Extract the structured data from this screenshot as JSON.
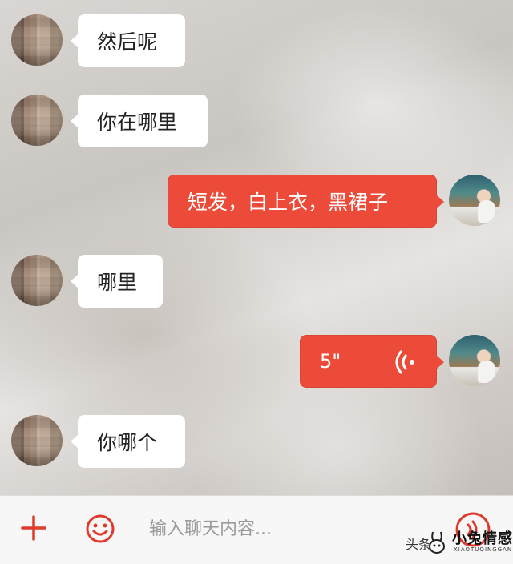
{
  "messages": [
    {
      "side": "in",
      "text": "然后呢"
    },
    {
      "side": "in",
      "text": "你在哪里"
    },
    {
      "side": "out",
      "text": "短发，白上衣，黑裙子"
    },
    {
      "side": "in",
      "text": "哪里"
    },
    {
      "side": "out",
      "type": "voice",
      "duration": "5\""
    },
    {
      "side": "in",
      "text": "你哪个"
    }
  ],
  "input_bar": {
    "placeholder": "输入聊天内容...",
    "plus_icon": "plus-icon",
    "emoji_icon": "emoji-icon",
    "voice_icon": "voice-record-icon"
  },
  "watermark": {
    "prefix": "头条",
    "name": "小兔情感",
    "sub": "XIAOTUQINGGAN"
  },
  "colors": {
    "accent": "#ec4b39",
    "incoming_bubble": "#ffffff"
  }
}
